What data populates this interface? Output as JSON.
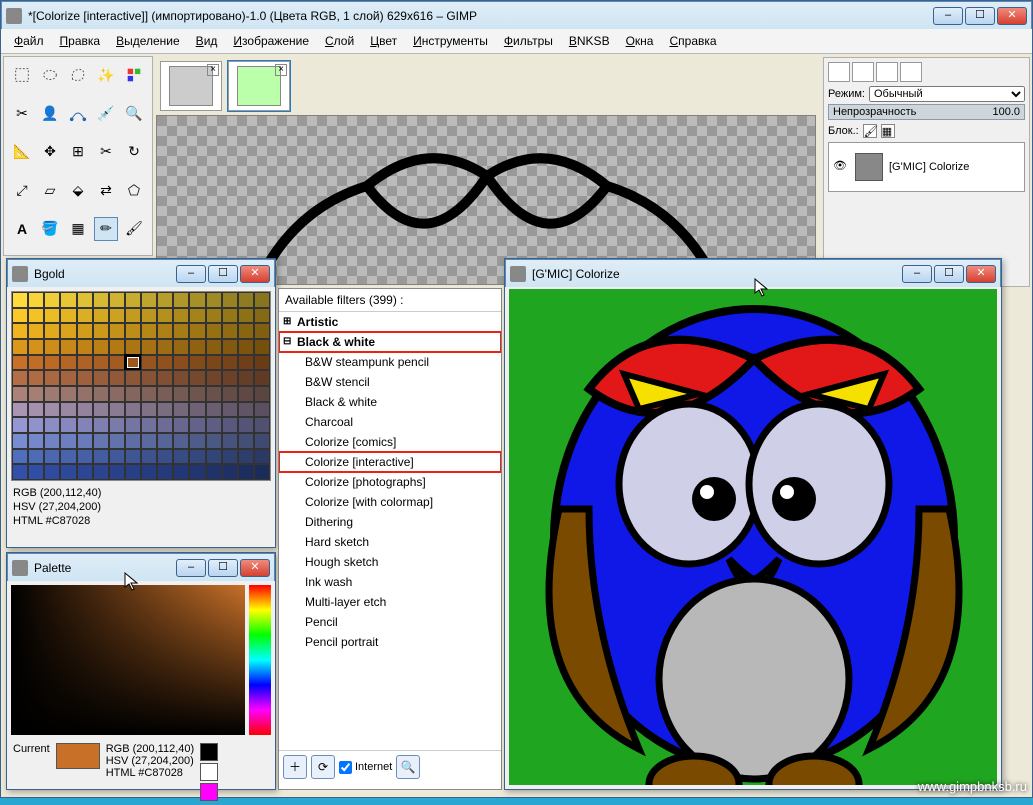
{
  "main_title": "*[Colorize [interactive]] (импортировано)-1.0 (Цвета RGB, 1 слой) 629x616 – GIMP",
  "menus": [
    "Файл",
    "Правка",
    "Выделение",
    "Вид",
    "Изображение",
    "Слой",
    "Цвет",
    "Инструменты",
    "Фильтры",
    "BNKSB",
    "Окна",
    "Справка"
  ],
  "layers": {
    "mode_label": "Режим:",
    "mode_value": "Обычный",
    "opacity_label": "Непрозрачность",
    "opacity_value": "100.0",
    "lock_label": "Блок.:",
    "layer_name": "[G'MIC] Colorize"
  },
  "bgold": {
    "title": "Bgold",
    "rgb": "RGB (200,112,40)",
    "hsv": "HSV (27,204,200)",
    "html": "HTML #C87028"
  },
  "palette": {
    "title": "Palette",
    "current_label": "Current",
    "rgb": "RGB (200,112,40)",
    "hsv": "HSV (27,204,200)",
    "html": "HTML #C87028"
  },
  "gmic": {
    "header": "Available filters (399) :",
    "cat_artistic": "Artistic",
    "cat_bw": "Black & white",
    "items": [
      "B&W steampunk pencil",
      "B&W stencil",
      "Black & white",
      "Charcoal",
      "Colorize [comics]",
      "Colorize [interactive]",
      "Colorize [photographs]",
      "Colorize [with colormap]",
      "Dithering",
      "Hard sketch",
      "Hough sketch",
      "Ink wash",
      "Multi-layer etch",
      "Pencil",
      "Pencil portrait"
    ],
    "internet": "Internet"
  },
  "colorize": {
    "title": "[G'MIC] Colorize"
  },
  "watermark": "www.gimpbnksb.ru"
}
